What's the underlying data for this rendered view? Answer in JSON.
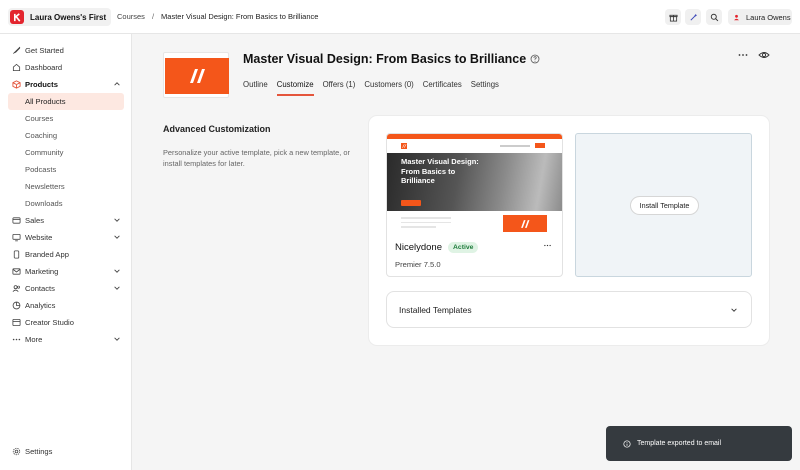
{
  "app": {
    "school_name": "Laura Owens's First",
    "user_name": "Laura Owens"
  },
  "breadcrumb": {
    "parent": "Courses",
    "separator": "/",
    "current": "Master Visual Design: From Basics to Brilliance"
  },
  "sidebar": {
    "items": [
      {
        "label": "Get Started",
        "icon": "rocket-icon"
      },
      {
        "label": "Dashboard",
        "icon": "home-icon"
      },
      {
        "label": "Products",
        "icon": "box-icon",
        "expanded": true
      },
      {
        "label": "All Products",
        "sub": true,
        "active": true
      },
      {
        "label": "Courses",
        "sub": true
      },
      {
        "label": "Coaching",
        "sub": true
      },
      {
        "label": "Community",
        "sub": true
      },
      {
        "label": "Podcasts",
        "sub": true
      },
      {
        "label": "Newsletters",
        "sub": true
      },
      {
        "label": "Downloads",
        "sub": true
      },
      {
        "label": "Sales",
        "icon": "card-icon"
      },
      {
        "label": "Website",
        "icon": "monitor-icon"
      },
      {
        "label": "Branded App",
        "icon": "phone-icon"
      },
      {
        "label": "Marketing",
        "icon": "mail-icon"
      },
      {
        "label": "Contacts",
        "icon": "users-icon"
      },
      {
        "label": "Analytics",
        "icon": "chart-icon"
      },
      {
        "label": "Creator Studio",
        "icon": "studio-icon"
      },
      {
        "label": "More",
        "icon": "dots-icon"
      }
    ],
    "settings_label": "Settings"
  },
  "course": {
    "title": "Master Visual Design: From Basics to Brilliance",
    "tabs": [
      "Outline",
      "Customize",
      "Offers (1)",
      "Customers (0)",
      "Certificates",
      "Settings"
    ],
    "active_tab": "Customize"
  },
  "customization": {
    "heading": "Advanced Customization",
    "description": "Personalize your active template, pick a new template, or install templates for later.",
    "template": {
      "name": "Nicelydone",
      "status": "Active",
      "version": "Premier 7.5.0",
      "preview_title": "Master Visual Design: From Basics to Brilliance"
    },
    "install_button": "Install Template",
    "installed_label": "Installed Templates"
  },
  "toast": {
    "message": "Template exported to email"
  },
  "colors": {
    "brand": "#f4561a",
    "active_tab_underline": "#e4553c",
    "active_nav_bg": "#fde8e1",
    "badge_bg": "#dff3e4",
    "badge_text": "#1e7b3b",
    "toast_bg": "#353a3f"
  }
}
